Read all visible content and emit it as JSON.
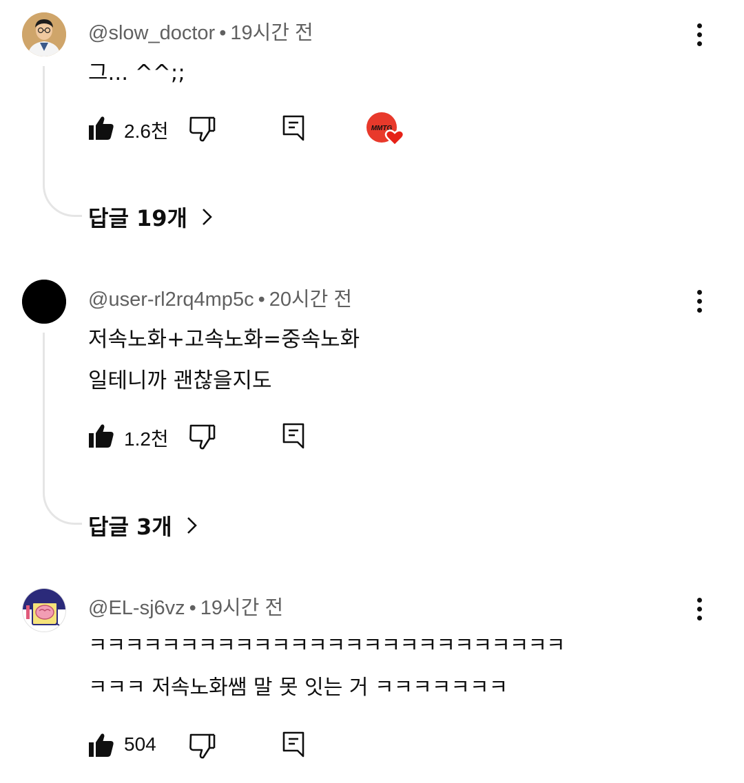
{
  "comments": [
    {
      "author": "@slow_doctor",
      "separator": "•",
      "time": "19시간 전",
      "lines": [
        "그... ^^;;"
      ],
      "likes": "2.6천",
      "replies_label": "답글 19개",
      "creator_badge_text": "MMTG",
      "avatar_icon": "doctor-avatar"
    },
    {
      "author": "@user-rl2rq4mp5c",
      "separator": "•",
      "time": "20시간 전",
      "lines": [
        "저속노화+고속노화=중속노화",
        "일테니까 괜찮을지도"
      ],
      "likes": "1.2천",
      "replies_label": "답글 3개",
      "avatar_icon": "black-circle-avatar"
    },
    {
      "author": "@EL-sj6vz",
      "separator": "•",
      "time": "19시간 전",
      "lines": [
        "ㅋㅋㅋㅋㅋㅋㅋㅋㅋㅋㅋㅋㅋㅋㅋㅋㅋㅋㅋㅋㅋㅋㅋㅋㅋㅋ",
        "ㅋㅋㅋ 저속노화쌤 말 못 잇는 거 ㅋㅋㅋㅋㅋㅋㅋ"
      ],
      "likes": "504",
      "avatar_icon": "brain-illustration-avatar"
    }
  ],
  "colors": {
    "text_primary": "#0f0f0f",
    "text_secondary": "#606060",
    "thread_line": "#e5e5e5",
    "creator_heart": "#e62117",
    "creator_badge": "#e8392b"
  }
}
